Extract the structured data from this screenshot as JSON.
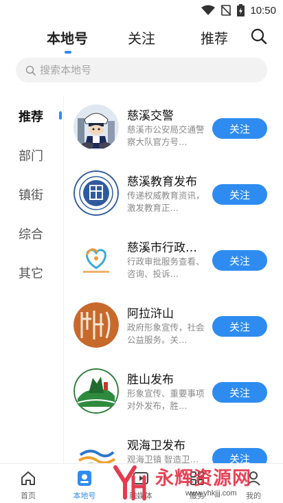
{
  "status_bar": {
    "time": "10:50"
  },
  "top_tabs": [
    {
      "label": "本地号",
      "active": true
    },
    {
      "label": "关注",
      "active": false
    },
    {
      "label": "推荐",
      "active": false
    }
  ],
  "search": {
    "placeholder": "搜索本地号"
  },
  "sidebar": {
    "items": [
      {
        "label": "推荐",
        "active": true
      },
      {
        "label": "部门",
        "active": false
      },
      {
        "label": "镇街",
        "active": false
      },
      {
        "label": "综合",
        "active": false
      },
      {
        "label": "其它",
        "active": false
      }
    ]
  },
  "accounts": [
    {
      "name": "慈溪交警",
      "desc": "慈溪市公安局交通警察大队官方号…",
      "follow_label": "关注",
      "avatar_icon": "police-mascot-icon"
    },
    {
      "name": "慈溪教育发布",
      "desc": "传递权威教育资讯，激发教育正…",
      "follow_label": "关注",
      "avatar_icon": "education-seal-icon"
    },
    {
      "name": "慈溪市行政…",
      "desc": "行政审批服务查看、咨询、投诉…",
      "follow_label": "关注",
      "avatar_icon": "heart-logo-icon"
    },
    {
      "name": "阿拉浒山",
      "desc": "政府形象宣传，社会公益服务。关…",
      "follow_label": "关注",
      "avatar_icon": "calligraphy-seal-icon"
    },
    {
      "name": "胜山发布",
      "desc": "形象宣传、重要事项对外发布，胜…",
      "follow_label": "关注",
      "avatar_icon": "landscape-logo-icon"
    },
    {
      "name": "观海卫发布",
      "desc": "观海卫镇 智造卫…",
      "follow_label": "关注",
      "avatar_icon": "wave-logo-icon"
    }
  ],
  "bottom_nav": [
    {
      "label": "首页",
      "icon": "home-icon",
      "active": false
    },
    {
      "label": "本地号",
      "icon": "local-account-icon",
      "active": true
    },
    {
      "label": "融媒体",
      "icon": "media-icon",
      "active": false
    },
    {
      "label": "服务",
      "icon": "service-icon",
      "active": false
    },
    {
      "label": "我的",
      "icon": "profile-icon",
      "active": false
    }
  ],
  "watermark": {
    "title": "永辉资源网",
    "url": "www.yhkjjj.com"
  },
  "colors": {
    "accent": "#2e8cf0",
    "text": "#222222",
    "muted": "#888888",
    "search_bg": "#f2f2f2"
  }
}
